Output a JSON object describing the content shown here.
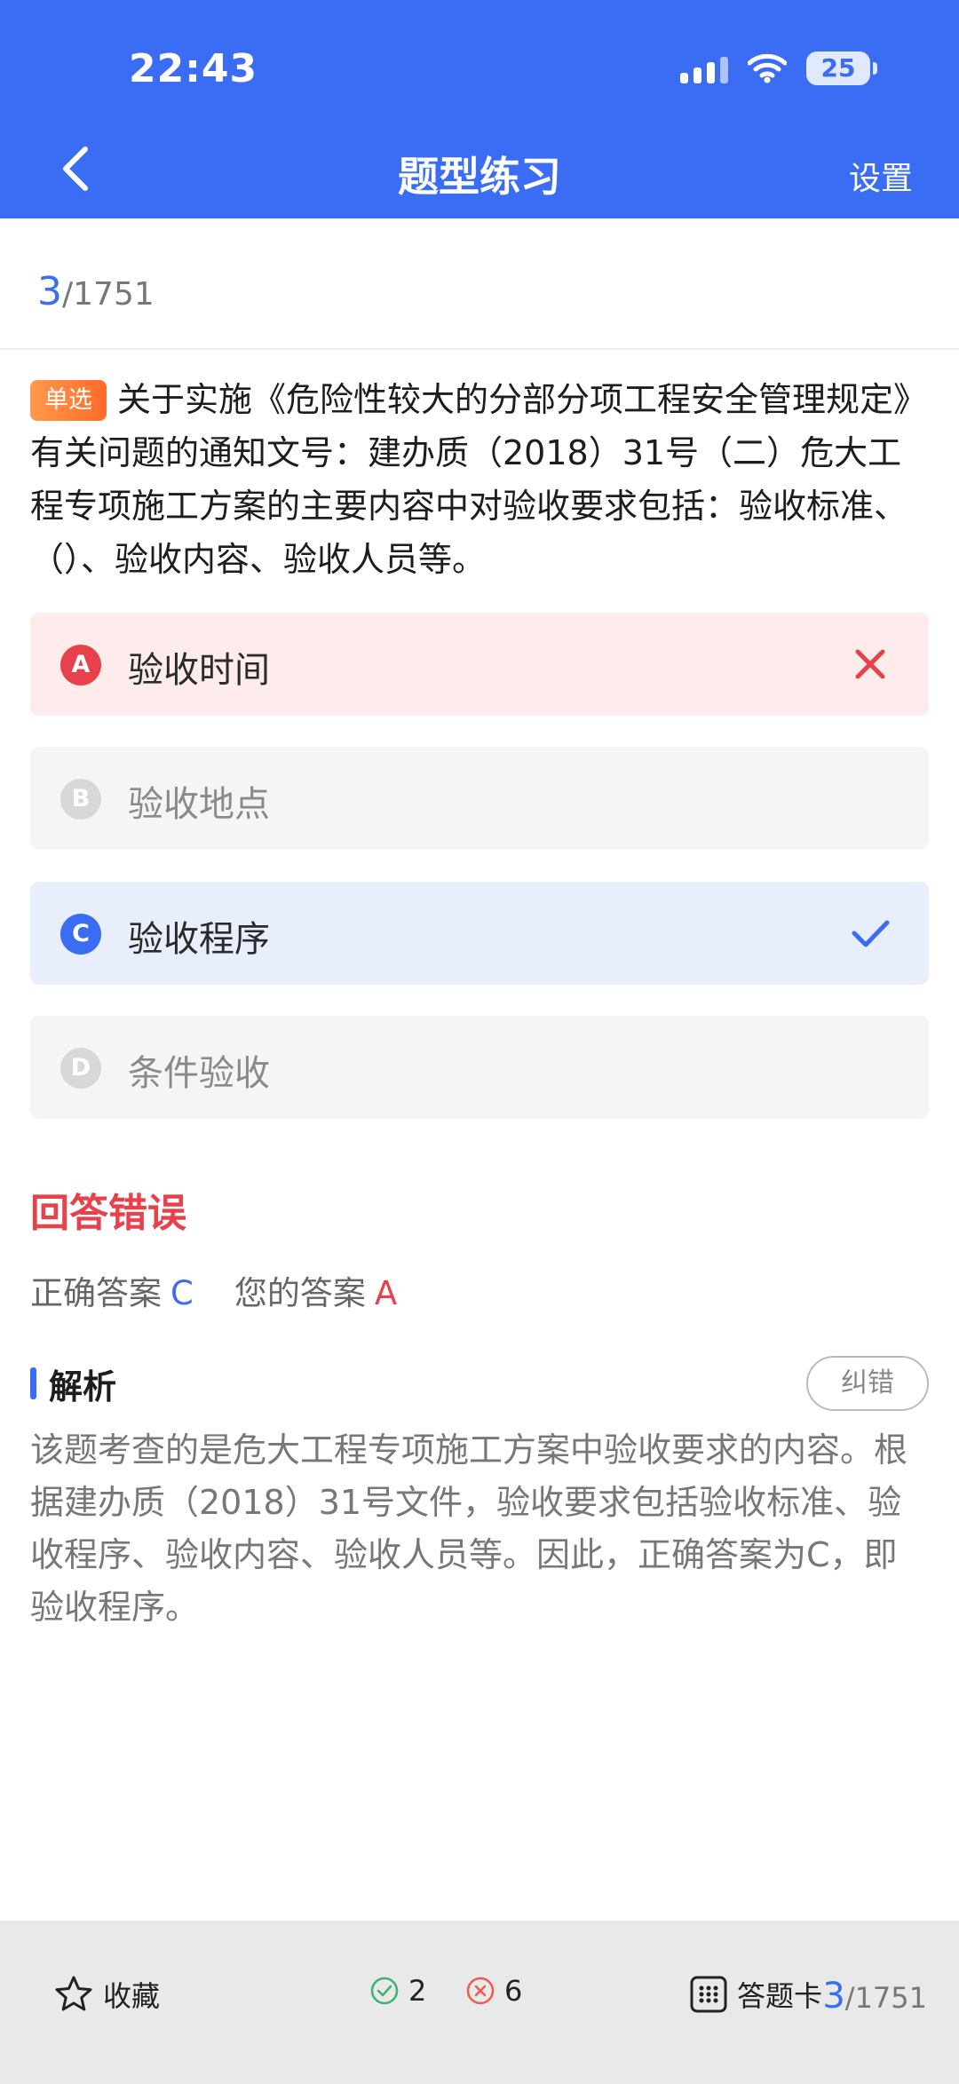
{
  "status_bar": {
    "time": "22:43",
    "battery": "25"
  },
  "nav": {
    "title": "题型练习",
    "settings_label": "设置"
  },
  "progress": {
    "current": "3",
    "total": "/1751"
  },
  "question": {
    "type_tag": "单选",
    "text": "关于实施《危险性较大的分部分项工程安全管理规定》有关问题的通知文号：建办质（2018）31号（二）危大工程专项施工方案的主要内容中对验收要求包括：验收标准、（）、验收内容、验收人员等。"
  },
  "options": [
    {
      "letter": "A",
      "text": "验收时间",
      "state": "wrong"
    },
    {
      "letter": "B",
      "text": "验收地点",
      "state": "neutral"
    },
    {
      "letter": "C",
      "text": "验收程序",
      "state": "correct"
    },
    {
      "letter": "D",
      "text": "条件验收",
      "state": "neutral"
    }
  ],
  "result": {
    "title": "回答错误",
    "correct_label": "正确答案",
    "correct_value": "C",
    "your_label": "您的答案",
    "your_value": "A"
  },
  "analysis": {
    "title": "解析",
    "report_label": "纠错",
    "text": "该题考查的是危大工程专项施工方案中验收要求的内容。根据建办质（2018）31号文件，验收要求包括验收标准、验收程序、验收内容、验收人员等。因此，正确答案为C，即验收程序。"
  },
  "bottom_bar": {
    "favorite_label": "收藏",
    "right_count": "2",
    "wrong_count": "6",
    "card_label": "答题卡",
    "current": "3",
    "total": "/1751"
  },
  "colors": {
    "primary": "#3a6cf4",
    "error": "#e8414b",
    "tag_orange": "#ff7a35",
    "success_green": "#3cb371"
  }
}
